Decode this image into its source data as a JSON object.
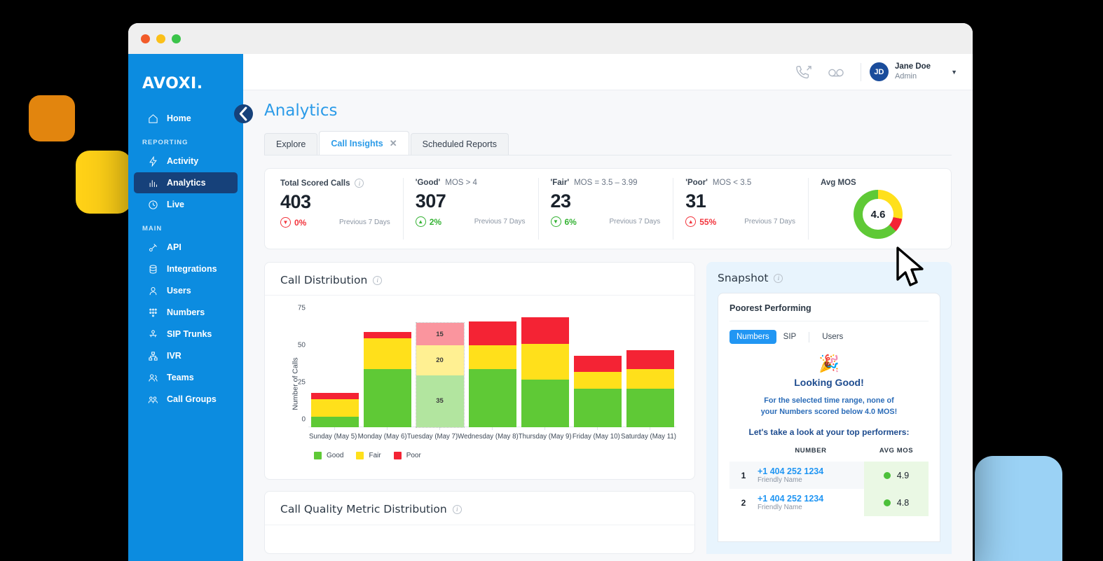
{
  "window": {
    "dots": [
      "close",
      "minimize",
      "maximize"
    ]
  },
  "sidebar": {
    "logo": "AVOXI.",
    "collapse_icon": "chevron-left-icon",
    "items": [
      {
        "label": "Home",
        "icon": "home-icon",
        "active": false,
        "group": null
      },
      {
        "label": "Activity",
        "icon": "bolt-icon",
        "active": false,
        "group": "REPORTING"
      },
      {
        "label": "Analytics",
        "icon": "bar-chart-icon",
        "active": true,
        "group": null
      },
      {
        "label": "Live",
        "icon": "live-icon",
        "active": false,
        "group": null
      },
      {
        "label": "API",
        "icon": "api-icon",
        "active": false,
        "group": "MAIN"
      },
      {
        "label": "Integrations",
        "icon": "database-icon",
        "active": false,
        "group": null
      },
      {
        "label": "Users",
        "icon": "user-icon",
        "active": false,
        "group": null
      },
      {
        "label": "Numbers",
        "icon": "numbers-icon",
        "active": false,
        "group": null
      },
      {
        "label": "SIP Trunks",
        "icon": "sip-trunk-icon",
        "active": false,
        "group": null
      },
      {
        "label": "IVR",
        "icon": "ivr-tree-icon",
        "active": false,
        "group": null
      },
      {
        "label": "Teams",
        "icon": "teams-icon",
        "active": false,
        "group": null
      },
      {
        "label": "Call Groups",
        "icon": "call-groups-icon",
        "active": false,
        "group": null
      }
    ],
    "groups": {
      "reporting": "REPORTING",
      "main": "MAIN"
    }
  },
  "topbar": {
    "call_icon": "outbound-call-icon",
    "voicemail_icon": "voicemail-icon",
    "avatar_initials": "JD",
    "user_name": "Jane Doe",
    "user_role": "Admin",
    "caret_icon": "chevron-down-icon"
  },
  "page": {
    "title": "Analytics"
  },
  "tabs": [
    {
      "label": "Explore",
      "active": false,
      "closable": false
    },
    {
      "label": "Call Insights",
      "active": true,
      "closable": true,
      "close_icon": "close-icon"
    },
    {
      "label": "Scheduled Reports",
      "active": false,
      "closable": false
    }
  ],
  "kpis": [
    {
      "label_bold": "Total Scored Calls",
      "label_rest": "",
      "has_info": true,
      "value": "403",
      "delta": "0%",
      "direction": "down",
      "compare": "Previous 7 Days"
    },
    {
      "label_bold": "'Good'",
      "label_rest": "MOS > 4",
      "has_info": false,
      "value": "307",
      "delta": "2%",
      "direction": "up",
      "compare": "Previous 7 Days"
    },
    {
      "label_bold": "'Fair'",
      "label_rest": "MOS = 3.5 – 3.99",
      "has_info": false,
      "value": "23",
      "delta": "6%",
      "direction": "down-good",
      "compare": "Previous 7 Days"
    },
    {
      "label_bold": "'Poor'",
      "label_rest": "MOS < 3.5",
      "has_info": false,
      "value": "31",
      "delta": "55%",
      "direction": "up-bad",
      "compare": "Previous 7 Days"
    }
  ],
  "avg_mos": {
    "label": "Avg MOS",
    "value": "4.6"
  },
  "chart_data": {
    "type": "bar",
    "title": "Call Distribution",
    "subtype": "stacked",
    "xlabel": "",
    "ylabel": "Number of Calls",
    "ylim": [
      0,
      80
    ],
    "yticks": [
      0,
      25,
      50,
      75
    ],
    "grid": false,
    "legend_position": "bottom-left",
    "categories": [
      "Sunday (May 5)",
      "Monday (May 6)",
      "Tuesday (May 7)",
      "Wednesday (May 8)",
      "Thursday (May 9)",
      "Friday (May 10)",
      "Saturday (May 11)"
    ],
    "series": [
      {
        "name": "Good",
        "color": "#5FC936",
        "values": [
          7,
          39,
          35,
          39,
          32,
          26,
          26
        ]
      },
      {
        "name": "Fair",
        "color": "#FFE01B",
        "values": [
          12,
          21,
          20,
          16,
          24,
          11,
          13
        ]
      },
      {
        "name": "Poor",
        "color": "#F42334",
        "values": [
          4,
          4,
          15,
          16,
          18,
          11,
          13
        ]
      }
    ],
    "highlighted_category": "Tuesday (May 7)",
    "highlighted_labels": {
      "Good": "35",
      "Fair": "20",
      "Poor": "15"
    }
  },
  "donut_chart": {
    "type": "pie",
    "title": "Avg MOS",
    "center_label": "4.6",
    "slices": [
      {
        "name": "Fair",
        "color": "#FFE01B",
        "percent": 28
      },
      {
        "name": "Poor",
        "color": "#F42334",
        "percent": 9
      },
      {
        "name": "Good",
        "color": "#5FC936",
        "percent": 63
      }
    ]
  },
  "snapshot": {
    "title": "Snapshot",
    "has_info": true,
    "sub_title": "Poorest Performing",
    "seg_tabs": [
      {
        "label": "Numbers",
        "active": true
      },
      {
        "label": "SIP",
        "active": false
      },
      {
        "label": "Users",
        "active": false
      }
    ],
    "party_icon": "party-popper-icon",
    "good_title": "Looking Good!",
    "good_msg_line1": "For the selected time range, none of",
    "good_msg_line2": "your Numbers scored below 4.0 MOS!",
    "cta": "Let's take a look at your top performers:",
    "table": {
      "headers": {
        "number": "NUMBER",
        "mos": "AVG MOS"
      },
      "rows": [
        {
          "rank": "1",
          "number": "+1 404 252 1234",
          "friendly": "Friendly Name",
          "mos": "4.9",
          "status_color": "#4CC03A"
        },
        {
          "rank": "2",
          "number": "+1 404 252 1234",
          "friendly": "Friendly Name",
          "mos": "4.8",
          "status_color": "#4CC03A"
        }
      ]
    }
  },
  "bottom_card": {
    "title": "Call Quality Metric Distribution",
    "has_info": true
  },
  "colors": {
    "brand_blue": "#0C8CE0",
    "sidebar_active": "#16417A",
    "accent_link": "#2196F3",
    "good": "#5FC936",
    "fair": "#FFE01B",
    "poor": "#F42334"
  }
}
